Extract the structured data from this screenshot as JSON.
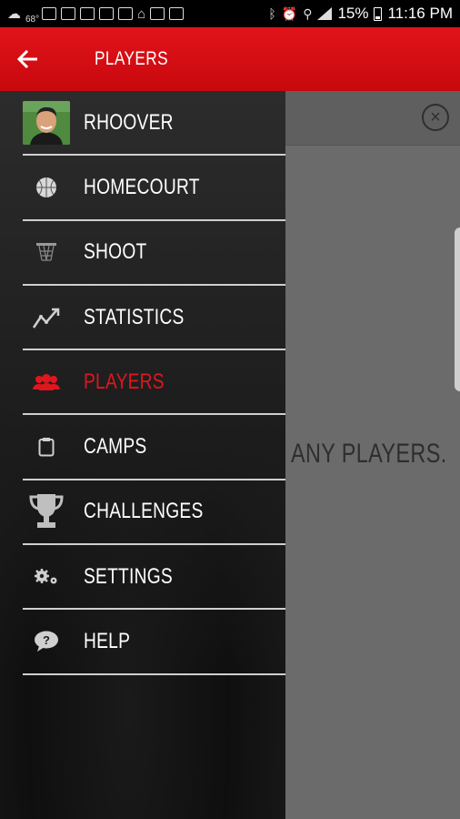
{
  "status_bar": {
    "temperature": "68°",
    "battery": "15%",
    "time": "11:16 PM"
  },
  "app_bar": {
    "title": "PLAYERS"
  },
  "main": {
    "empty_message": "ANY PLAYERS."
  },
  "drawer": {
    "items": [
      {
        "label": "RHOOVER",
        "icon": "avatar",
        "active": false
      },
      {
        "label": "HOMECOURT",
        "icon": "basketball-icon",
        "active": false
      },
      {
        "label": "SHOOT",
        "icon": "hoop-icon",
        "active": false
      },
      {
        "label": "STATISTICS",
        "icon": "chart-trend-icon",
        "active": false
      },
      {
        "label": "PLAYERS",
        "icon": "players-icon",
        "active": true
      },
      {
        "label": "CAMPS",
        "icon": "clipboard-icon",
        "active": false
      },
      {
        "label": "CHALLENGES",
        "icon": "trophy-icon",
        "active": false
      },
      {
        "label": "SETTINGS",
        "icon": "gears-icon",
        "active": false
      },
      {
        "label": "HELP",
        "icon": "help-bubble-icon",
        "active": false
      }
    ]
  },
  "colors": {
    "accent": "#e0141a",
    "drawer_bg": "#1c1c1c",
    "overlay": "#6b6b6b"
  }
}
